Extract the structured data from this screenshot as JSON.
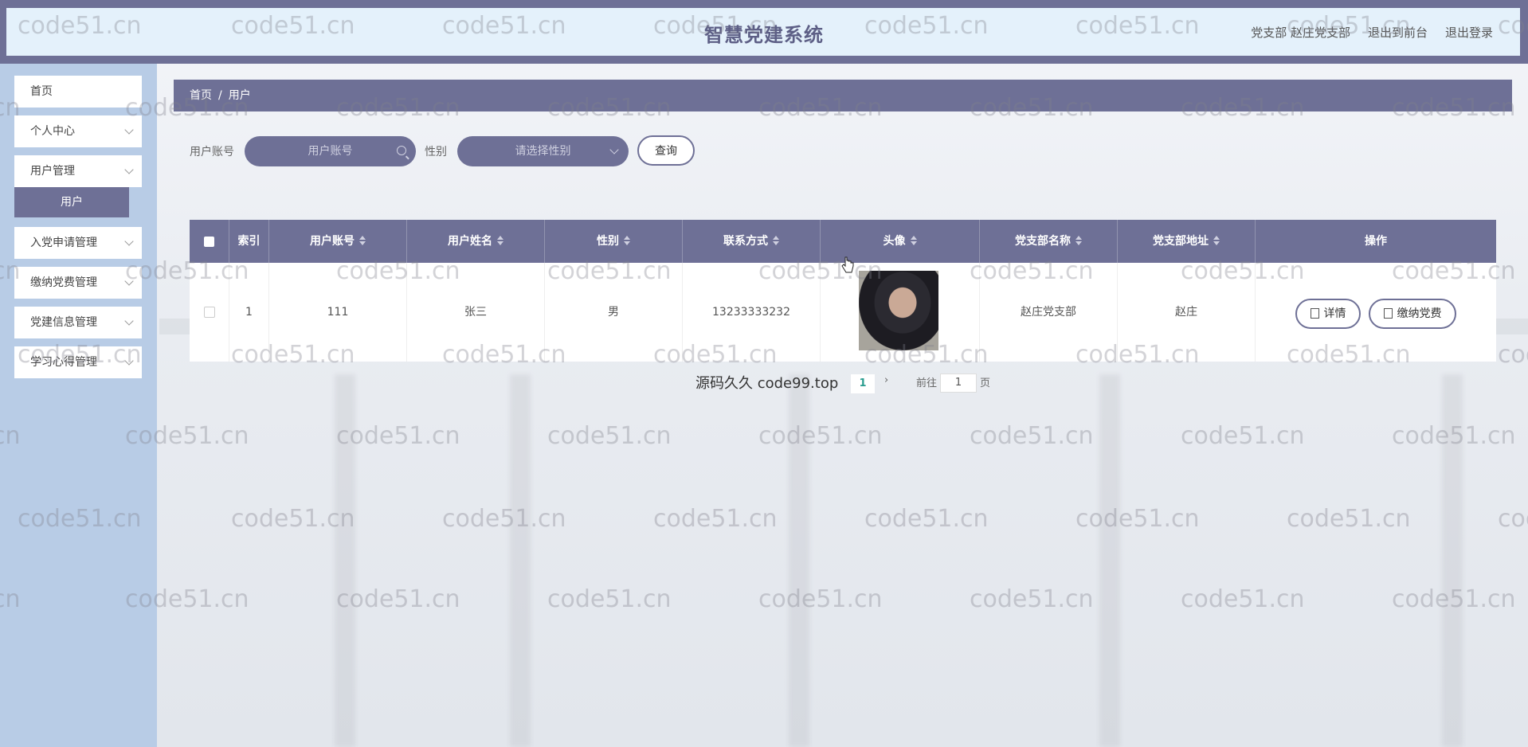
{
  "app": {
    "title": "智慧党建系统",
    "header_links": [
      "党支部 赵庄党支部",
      "退出到前台",
      "退出登录"
    ]
  },
  "sidebar": {
    "items": [
      {
        "label": "首页",
        "has_arrow": false
      },
      {
        "label": "个人中心",
        "has_arrow": true
      },
      {
        "label": "用户管理",
        "has_arrow": true
      },
      {
        "label": "入党申请管理",
        "has_arrow": true
      },
      {
        "label": "缴纳党费管理",
        "has_arrow": true
      },
      {
        "label": "党建信息管理",
        "has_arrow": true
      },
      {
        "label": "学习心得管理",
        "has_arrow": true
      }
    ],
    "subitem": "用户"
  },
  "breadcrumb": [
    "首页",
    "用户"
  ],
  "search": {
    "account_label": "用户账号",
    "account_placeholder": "用户账号",
    "gender_label": "性别",
    "gender_placeholder": "请选择性别",
    "query_button": "查询"
  },
  "table": {
    "columns": [
      "索引",
      "用户账号",
      "用户姓名",
      "性别",
      "联系方式",
      "头像",
      "党支部名称",
      "党支部地址",
      "操作"
    ],
    "rows": [
      {
        "index": "1",
        "account": "111",
        "name": "张三",
        "gender": "男",
        "phone": "13233333232",
        "branch_name": "赵庄党支部",
        "branch_address": "赵庄"
      }
    ],
    "actions": [
      "详情",
      "缴纳党费"
    ]
  },
  "pagination": {
    "current_page": "1",
    "goto_label": "前往",
    "goto_value": "1",
    "page_suffix": "页",
    "overlay_text": "源码久久 code99.top"
  },
  "watermark": "code51.cn",
  "colors": {
    "primary": "#6e7096",
    "sidebar_bg": "#b8cce6",
    "header_inner": "#e4f1fb"
  }
}
